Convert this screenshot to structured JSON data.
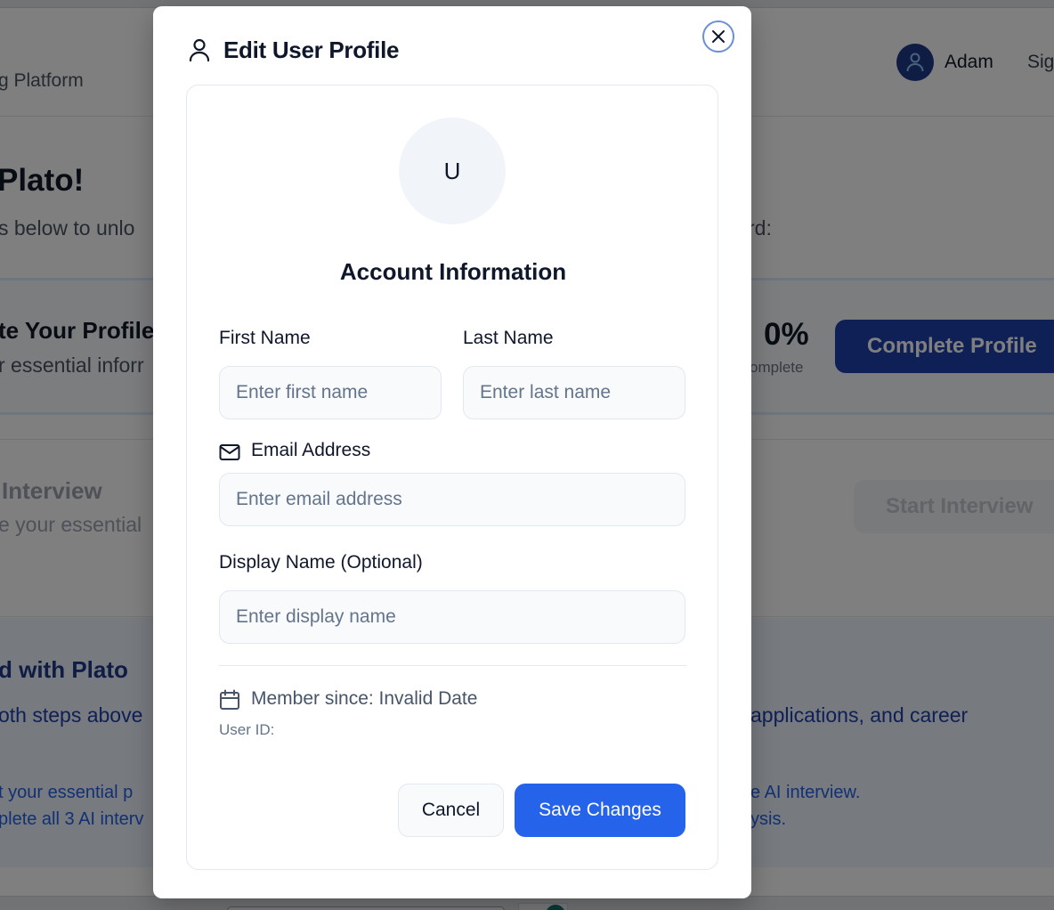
{
  "background": {
    "brand_fragment": "g Platform",
    "user_name": "Adam",
    "signout_fragment": "Sig",
    "welcome_title_fragment": "Plato!",
    "welcome_sub_fragment": "s below to unlo",
    "welcome_sub_tail": "rd:",
    "profile_card": {
      "title_fragment": "te Your Profile",
      "sub_fragment": "r essential inforr",
      "percent": "0%",
      "percent_label": "omplete",
      "button_label": "Complete Profile"
    },
    "interview_card": {
      "title_fragment": "Interview",
      "sub_fragment": "e your essential",
      "button_label": "Start Interview"
    },
    "plato_section": {
      "title_fragment": "d with Plato",
      "line1_fragment": "oth steps above",
      "line1_tail": "applications, and career",
      "list1_fragment": "t your essential p",
      "list1_tail": "e AI interview.",
      "list2_fragment": "plete all 3 AI interv",
      "list2_tail": "ysis."
    }
  },
  "modal": {
    "header_icon": "user-icon",
    "title": "Edit User Profile",
    "close_icon": "close-icon",
    "avatar_initial": "U",
    "section_title": "Account Information",
    "fields": {
      "first_name": {
        "label": "First Name",
        "value": "",
        "placeholder": "Enter first name"
      },
      "last_name": {
        "label": "Last Name",
        "value": "",
        "placeholder": "Enter last name"
      },
      "email": {
        "label": "Email Address",
        "icon": "mail-icon",
        "value": "",
        "placeholder": "Enter email address"
      },
      "display_name": {
        "label": "Display Name (Optional)",
        "value": "",
        "placeholder": "Enter display name"
      }
    },
    "member_since": {
      "icon": "calendar-icon",
      "text": "Member since: Invalid Date"
    },
    "user_id": "User ID:",
    "buttons": {
      "cancel": "Cancel",
      "save": "Save Changes"
    }
  },
  "colors": {
    "primary": "#2563eb",
    "overlay": "rgba(0,0,0,0.5)",
    "close_ring": "#6b8fd6"
  }
}
